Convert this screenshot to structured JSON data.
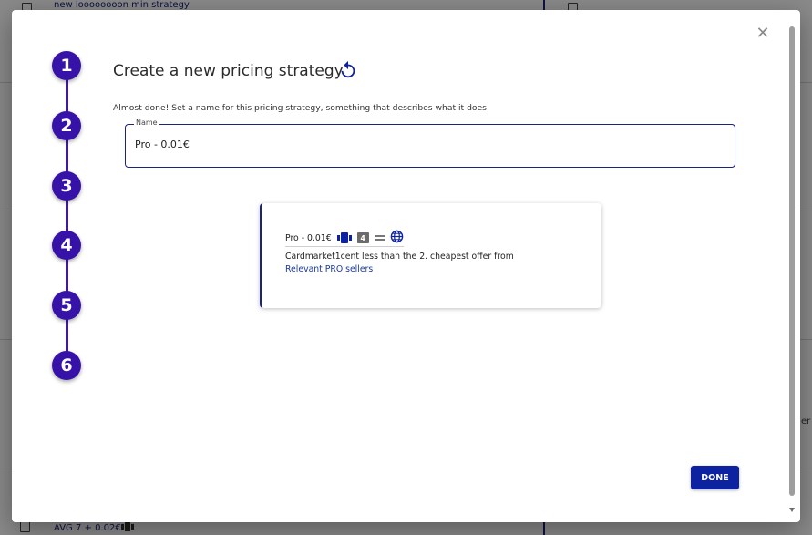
{
  "background": {
    "top_strategy_text": "new loooooooon min strategy",
    "bottom_strategy_text": "AVG 7 + 0.02€",
    "right_edge_text": "er"
  },
  "modal": {
    "title": "Create a new pricing strategy",
    "help_text": "Almost done! Set a name for this pricing strategy, something that describes what it does.",
    "steps": [
      "1",
      "2",
      "3",
      "4",
      "5",
      "6"
    ],
    "name_field": {
      "label": "Name",
      "value": "Pro - 0.01€"
    },
    "preview": {
      "name": "Pro - 0.01€",
      "badge_number": "4",
      "description": "Cardmarket1cent less than the 2. cheapest offer from",
      "link_text": "Relevant PRO sellers",
      "icons": [
        "cards-icon",
        "number-badge",
        "equals-icon",
        "globe-icon"
      ]
    },
    "done_label": "DONE"
  },
  "colors": {
    "primary": "#0d22a0",
    "stepper": "#3712a8",
    "accent_border": "#1a237e"
  }
}
